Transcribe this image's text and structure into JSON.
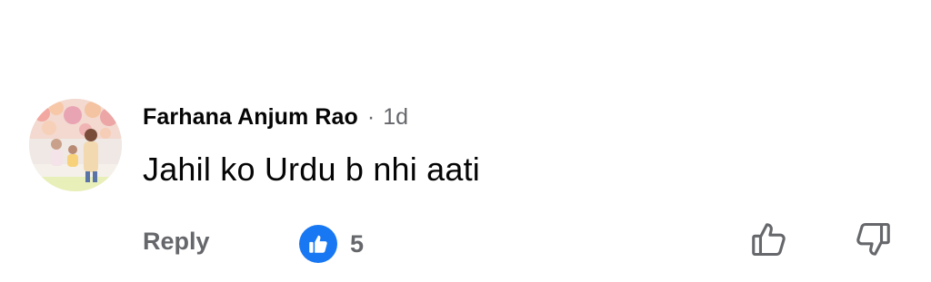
{
  "comment": {
    "author": "Farhana Anjum Rao",
    "separator": "·",
    "timestamp": "1d",
    "text": "Jahil ko Urdu b nhi aati",
    "avatar_icon": "profile-photo"
  },
  "actions": {
    "reply_label": "Reply",
    "reaction_icon": "like-thumb-icon",
    "reaction_count": "5",
    "upvote_icon": "thumbs-up-outline-icon",
    "downvote_icon": "thumbs-down-outline-icon"
  },
  "colors": {
    "text_primary": "#050505",
    "text_secondary": "#65676b",
    "like_blue": "#1877f2"
  }
}
